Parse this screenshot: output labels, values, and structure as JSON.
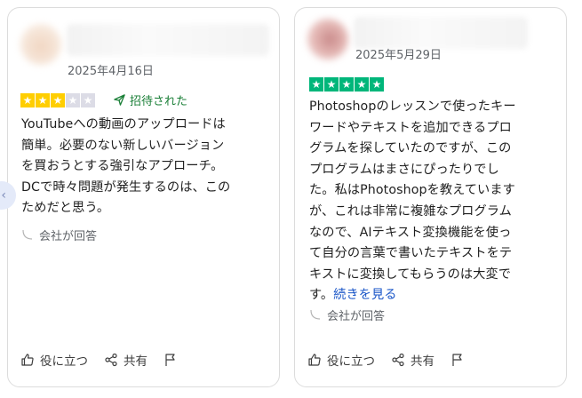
{
  "reviews": [
    {
      "date": "2025年4月16日",
      "rating": 3,
      "invited_label": "招待された",
      "text": "YouTubeへの動画のアップロードは\n簡単。必要のない新しいバージョン\nを買おうとする強引なアプローチ。\nDCで時々問題が発生するのは、この\nためだと思う。",
      "more_label": "",
      "reply_label": "会社が回答"
    },
    {
      "date": "2025年5月29日",
      "rating": 5,
      "text": "Photoshopのレッスンで使ったキー\nワードやテキストを追加できるプロ\nグラムを探していたのですが、この\nプログラムはまさにぴったりでし\nた。私はPhotoshopを教えています\nが、これは非常に複雑なプログラム\nなので、AIテキスト変換機能を使っ\nて自分の言葉で書いたテキストをテ\nキストに変換してもらうのは大変で\nす。",
      "more_label": "続きを見る",
      "reply_label": "会社が回答"
    }
  ],
  "actions": {
    "helpful_label": "役に立つ",
    "share_label": "共有"
  },
  "icons": {
    "star": "star-icon",
    "invited": "send-icon",
    "reply": "reply-curve-icon",
    "helpful": "thumbs-up-icon",
    "share": "share-icon",
    "flag": "flag-icon",
    "prev": "chevron-left-icon"
  },
  "colors": {
    "star_3": "#ffce00",
    "star_5": "#00b67a",
    "star_off": "#dcdce6",
    "invited": "#1a7f37",
    "link": "#1a56c8"
  }
}
